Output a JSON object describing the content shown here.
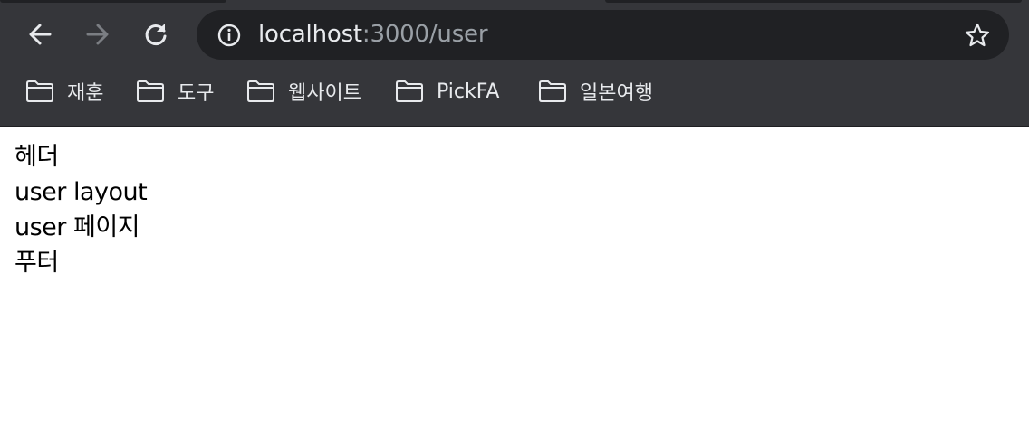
{
  "browser": {
    "url_host": "localhost",
    "url_path": ":3000/user",
    "icons": {
      "back": "arrow-left-icon",
      "forward": "arrow-right-icon",
      "reload": "reload-icon",
      "site_info": "info-circle-icon",
      "bookmark_star": "star-outline-icon",
      "bookmark_folder": "folder-icon"
    },
    "colors": {
      "chrome_bg": "#35363a",
      "omnibox_bg": "#202124",
      "text_primary": "#e8eaed",
      "text_muted": "#9aa0a6"
    }
  },
  "bookmarks": [
    {
      "label": "재훈"
    },
    {
      "label": "도구"
    },
    {
      "label": "웹사이트"
    },
    {
      "label": "PickFA"
    },
    {
      "label": "일본여행"
    }
  ],
  "page": {
    "header_text": "헤더",
    "layout_text": "user layout",
    "page_text": "user 페이지",
    "footer_text": "푸터"
  }
}
